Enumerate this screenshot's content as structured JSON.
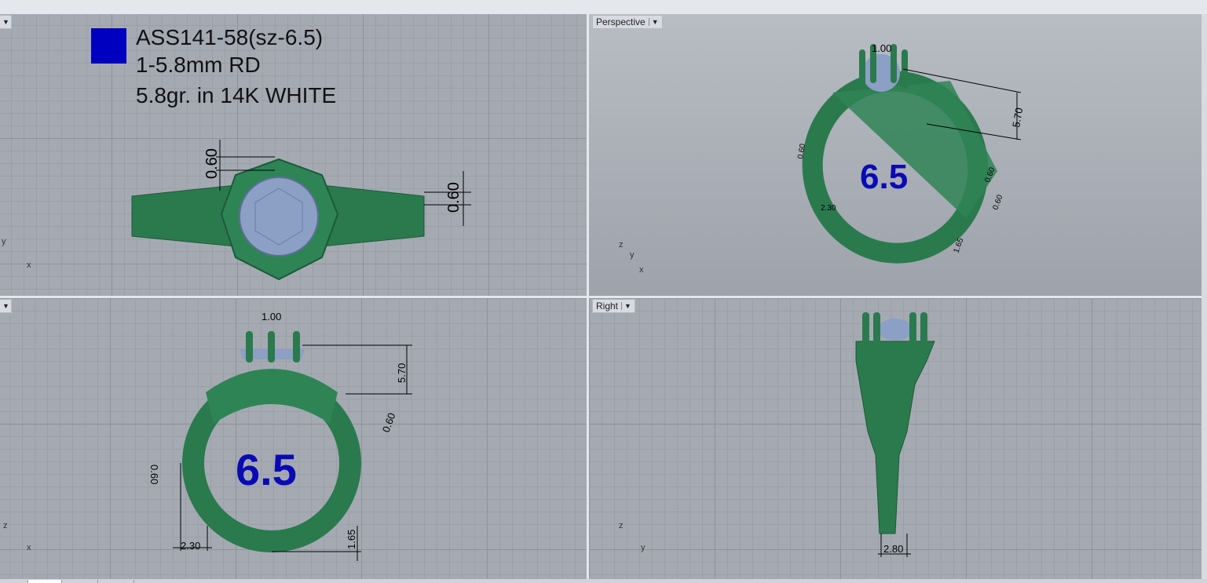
{
  "viewports": {
    "top": {
      "label": "",
      "notes": [
        "ASS141-58(sz-6.5)",
        "1-5.8mm RD",
        "5.8gr. in 14K WHITE"
      ],
      "dims": [
        "0.60",
        "0.60"
      ],
      "axes": [
        "y",
        "x"
      ]
    },
    "perspective": {
      "label": "Perspective",
      "size": "6.5",
      "dims": [
        "1.00",
        "5.70",
        "0.60",
        "0.60",
        "0.60",
        "2.30",
        "1.65"
      ],
      "axes": [
        "z",
        "y",
        "x"
      ]
    },
    "front": {
      "label": "",
      "size": "6.5",
      "dims": [
        "1.00",
        "5.70",
        "0.60",
        "0.60",
        "2.30",
        "1.65"
      ],
      "axes": [
        "z",
        "x"
      ]
    },
    "right": {
      "label": "Right",
      "dims": [
        "2.80"
      ],
      "axes": [
        "z",
        "y"
      ]
    }
  },
  "colors": {
    "ring": "#2a7a4e",
    "stone": "#8c9fc4",
    "size_text": "#0a0ab4",
    "legend": "#0000c0"
  }
}
